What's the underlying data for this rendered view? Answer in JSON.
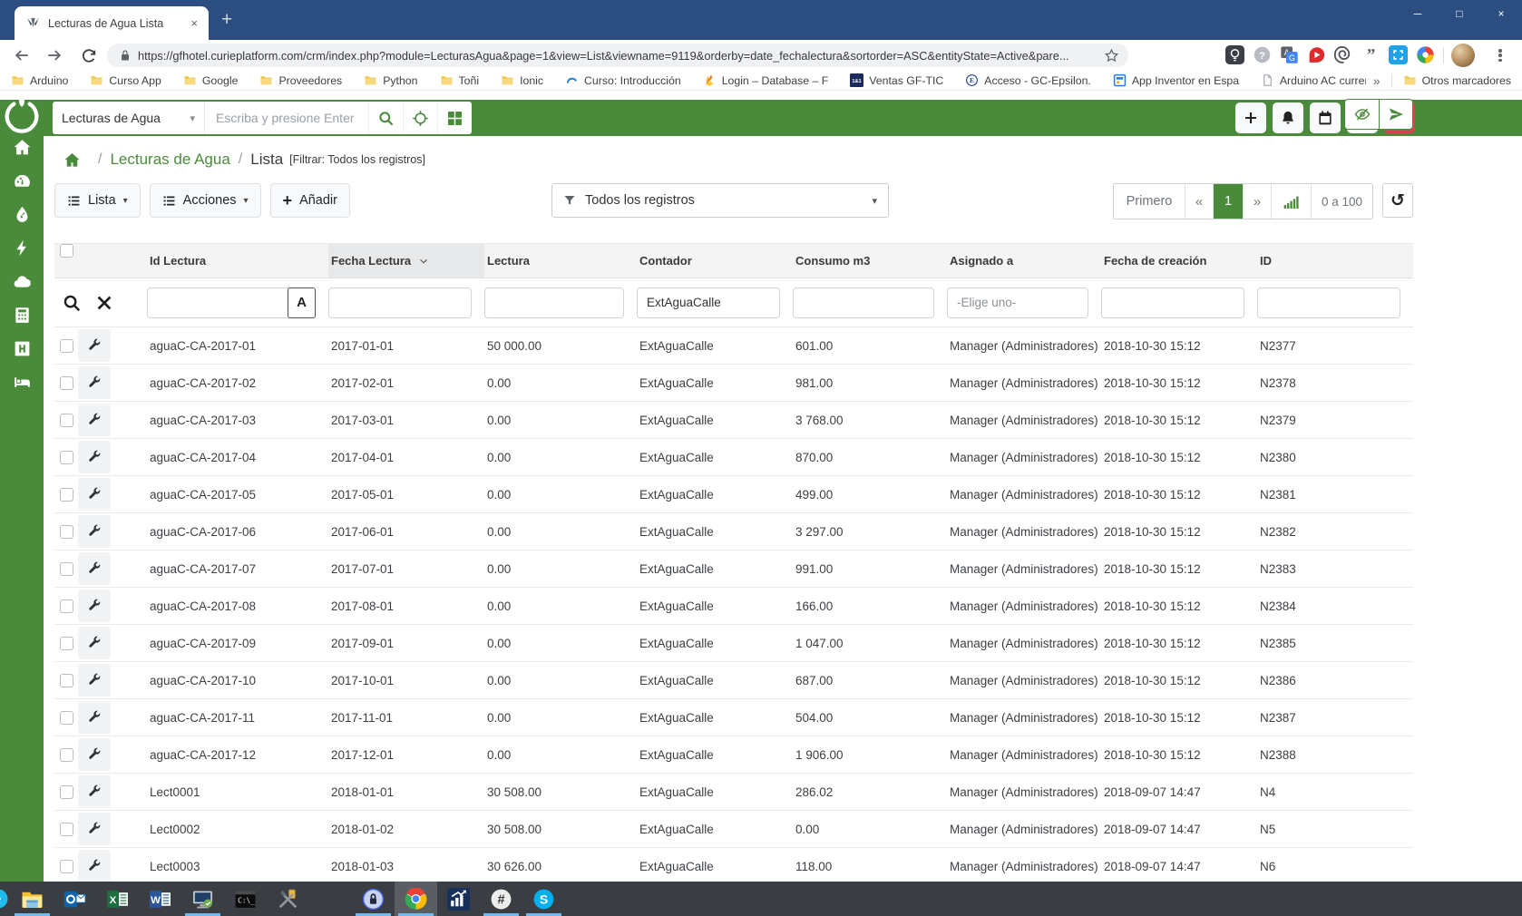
{
  "window": {
    "controls": {
      "minimize": "─",
      "maximize": "□",
      "close": "×"
    }
  },
  "browser": {
    "tab_title": "Lecturas de Agua Lista",
    "tab_close": "×",
    "new_tab": "+",
    "url": "https://gfhotel.curieplatform.com/crm/index.php?module=LecturasAgua&page=1&view=List&viewname=9119&orderby=date_fechalectura&sortorder=ASC&entityState=Active&pare...",
    "extension_icons": [
      "lightbulb-ext",
      "help-ext",
      "translate-ext",
      "redarrow-ext",
      "spiral-ext",
      "quote-ext",
      "screenshot-ext",
      "lighthouse-ext"
    ],
    "bookmarks": [
      {
        "label": "Arduino",
        "icon": "folder"
      },
      {
        "label": "Curso App",
        "icon": "folder"
      },
      {
        "label": "Google",
        "icon": "folder"
      },
      {
        "label": "Proveedores",
        "icon": "folder"
      },
      {
        "label": "Python",
        "icon": "folder"
      },
      {
        "label": "Toñi",
        "icon": "folder"
      },
      {
        "label": "Ionic",
        "icon": "folder"
      },
      {
        "label": "Curso: Introducción",
        "icon": "wave"
      },
      {
        "label": "Login – Database – F",
        "icon": "firebase"
      },
      {
        "label": "Ventas GF-TIC",
        "icon": "oneandone"
      },
      {
        "label": "Acceso - GC-Epsilon.",
        "icon": "epsilon"
      },
      {
        "label": "App Inventor en Espa",
        "icon": "appinventor"
      },
      {
        "label": "Arduino AC current i",
        "icon": "page"
      }
    ],
    "bookmarks_overflow": "»",
    "other_bookmarks": "Otros marcadores"
  },
  "app": {
    "colors": {
      "primary_green": "#4a8b3b",
      "power_red": "#dc4150",
      "titlebar_blue": "#2c4d80",
      "taskbar_gray": "#3a3d42"
    },
    "navbar": {
      "module_selector": "Lecturas de Agua",
      "selector_caret": "▾",
      "search_placeholder": "Escriba y presione Enter"
    },
    "sidebar": [
      {
        "id": "home",
        "icon": "home"
      },
      {
        "id": "dashboard",
        "icon": "gauge"
      },
      {
        "id": "water",
        "icon": "droplet"
      },
      {
        "id": "electricity",
        "icon": "bolt"
      },
      {
        "id": "cloud",
        "icon": "cloud"
      },
      {
        "id": "calculator",
        "icon": "calculator"
      },
      {
        "id": "hotel",
        "icon": "h-square"
      },
      {
        "id": "rooms",
        "icon": "bed"
      }
    ],
    "breadcrumb": {
      "separator": "/",
      "module": "Lecturas de Agua",
      "view": "Lista",
      "filter_note": "[Filtrar: Todos los registros]"
    },
    "toolbar": {
      "lista_label": "Lista",
      "acciones_label": "Acciones",
      "anadir_label": "Añadir",
      "anadir_plus": "+",
      "caret": "▾",
      "filter_selected": "Todos los registros"
    },
    "pagination": {
      "first_label": "Primero",
      "prev_label": "«",
      "current_page": "1",
      "next_label": "»",
      "range_label": "0 a 100",
      "refresh_glyph": "↺"
    }
  },
  "table": {
    "columns": [
      {
        "key": "id_lectura",
        "label": "Id Lectura",
        "sorted": false
      },
      {
        "key": "fecha_lectura",
        "label": "Fecha Lectura",
        "sorted": true
      },
      {
        "key": "lectura",
        "label": "Lectura",
        "sorted": false
      },
      {
        "key": "contador",
        "label": "Contador",
        "sorted": false
      },
      {
        "key": "consumo_m3",
        "label": "Consumo m3",
        "sorted": false
      },
      {
        "key": "asignado_a",
        "label": "Asignado a",
        "sorted": false
      },
      {
        "key": "fecha_creacion",
        "label": "Fecha de creación",
        "sorted": false
      },
      {
        "key": "id",
        "label": "ID",
        "sorted": false
      }
    ],
    "filter_row": {
      "case_button_label": "A",
      "types": [
        "text",
        "text",
        "text",
        "text",
        "text",
        "select",
        "text",
        "text"
      ],
      "values": [
        "",
        "",
        "",
        "ExtAguaCalle",
        "",
        "-Elige uno-",
        "",
        ""
      ]
    },
    "rows": [
      [
        "aguaC-CA-2017-01",
        "2017-01-01",
        "50 000.00",
        "ExtAguaCalle",
        "601.00",
        "Manager (Administradores)",
        "2018-10-30 15:12",
        "N2377"
      ],
      [
        "aguaC-CA-2017-02",
        "2017-02-01",
        "0.00",
        "ExtAguaCalle",
        "981.00",
        "Manager (Administradores)",
        "2018-10-30 15:12",
        "N2378"
      ],
      [
        "aguaC-CA-2017-03",
        "2017-03-01",
        "0.00",
        "ExtAguaCalle",
        "3 768.00",
        "Manager (Administradores)",
        "2018-10-30 15:12",
        "N2379"
      ],
      [
        "aguaC-CA-2017-04",
        "2017-04-01",
        "0.00",
        "ExtAguaCalle",
        "870.00",
        "Manager (Administradores)",
        "2018-10-30 15:12",
        "N2380"
      ],
      [
        "aguaC-CA-2017-05",
        "2017-05-01",
        "0.00",
        "ExtAguaCalle",
        "499.00",
        "Manager (Administradores)",
        "2018-10-30 15:12",
        "N2381"
      ],
      [
        "aguaC-CA-2017-06",
        "2017-06-01",
        "0.00",
        "ExtAguaCalle",
        "3 297.00",
        "Manager (Administradores)",
        "2018-10-30 15:12",
        "N2382"
      ],
      [
        "aguaC-CA-2017-07",
        "2017-07-01",
        "0.00",
        "ExtAguaCalle",
        "991.00",
        "Manager (Administradores)",
        "2018-10-30 15:12",
        "N2383"
      ],
      [
        "aguaC-CA-2017-08",
        "2017-08-01",
        "0.00",
        "ExtAguaCalle",
        "166.00",
        "Manager (Administradores)",
        "2018-10-30 15:12",
        "N2384"
      ],
      [
        "aguaC-CA-2017-09",
        "2017-09-01",
        "0.00",
        "ExtAguaCalle",
        "1 047.00",
        "Manager (Administradores)",
        "2018-10-30 15:12",
        "N2385"
      ],
      [
        "aguaC-CA-2017-10",
        "2017-10-01",
        "0.00",
        "ExtAguaCalle",
        "687.00",
        "Manager (Administradores)",
        "2018-10-30 15:12",
        "N2386"
      ],
      [
        "aguaC-CA-2017-11",
        "2017-11-01",
        "0.00",
        "ExtAguaCalle",
        "504.00",
        "Manager (Administradores)",
        "2018-10-30 15:12",
        "N2387"
      ],
      [
        "aguaC-CA-2017-12",
        "2017-12-01",
        "0.00",
        "ExtAguaCalle",
        "1 906.00",
        "Manager (Administradores)",
        "2018-10-30 15:12",
        "N2388"
      ],
      [
        "Lect0001",
        "2018-01-01",
        "30 508.00",
        "ExtAguaCalle",
        "286.02",
        "Manager (Administradores)",
        "2018-09-07 14:47",
        "N4"
      ],
      [
        "Lect0002",
        "2018-01-02",
        "30 508.00",
        "ExtAguaCalle",
        "0.00",
        "Manager (Administradores)",
        "2018-09-07 14:47",
        "N5"
      ],
      [
        "Lect0003",
        "2018-01-03",
        "30 626.00",
        "ExtAguaCalle",
        "118.00",
        "Manager (Administradores)",
        "2018-09-07 14:47",
        "N6"
      ]
    ]
  },
  "taskbar": {
    "items": [
      {
        "icon": "file-explorer",
        "running": true
      },
      {
        "icon": "outlook",
        "running": false
      },
      {
        "icon": "excel",
        "running": false
      },
      {
        "icon": "word",
        "running": false
      },
      {
        "icon": "remote-desktop",
        "running": true
      },
      {
        "icon": "terminal",
        "running": false
      },
      {
        "icon": "admin-tools",
        "running": false
      },
      {
        "icon": "internet-explorer",
        "running": false
      },
      {
        "icon": "keepass",
        "running": true
      },
      {
        "icon": "chrome",
        "running": true,
        "active": true
      },
      {
        "icon": "stats-app",
        "running": false
      },
      {
        "icon": "hash-app",
        "running": true
      },
      {
        "icon": "skype",
        "running": true
      }
    ]
  }
}
